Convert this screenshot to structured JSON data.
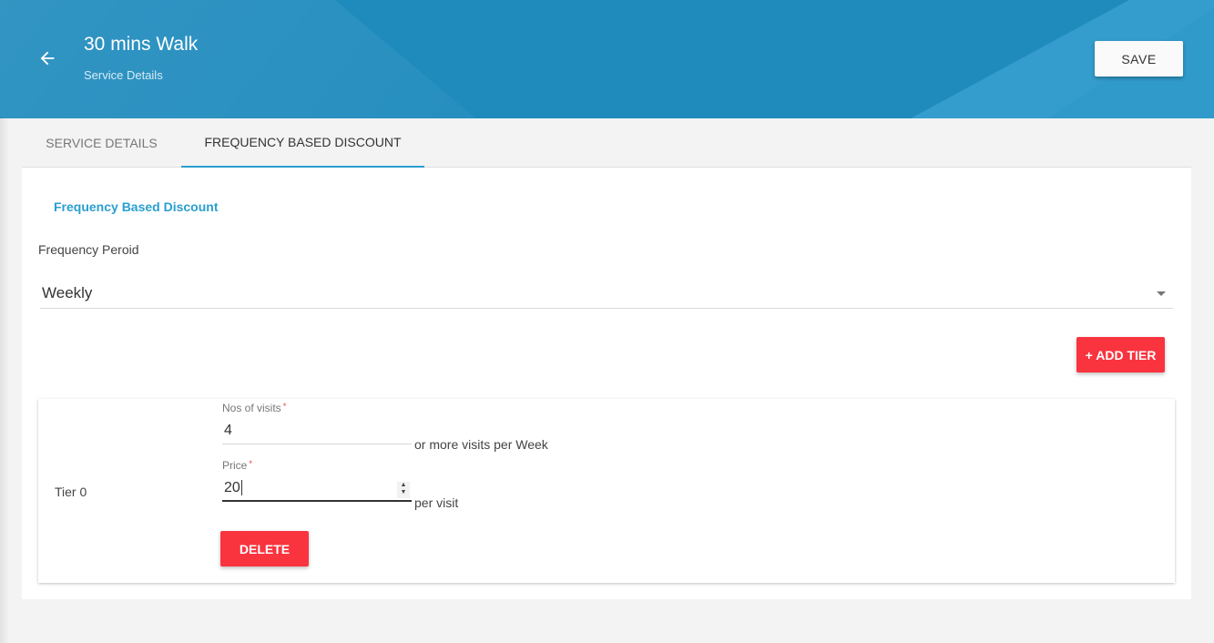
{
  "header": {
    "title": "30 mins Walk",
    "subtitle": "Service Details",
    "back_icon": "arrow-left-icon",
    "save_label": "SAVE"
  },
  "tabs": [
    {
      "label": "SERVICE DETAILS",
      "active": false
    },
    {
      "label": "FREQUENCY BASED DISCOUNT",
      "active": true
    }
  ],
  "panel": {
    "section_title": "Frequency Based Discount",
    "frequency_period_label": "Frequency Peroid",
    "frequency_period_value": "Weekly",
    "add_tier_label": "+ ADD TIER"
  },
  "tiers": [
    {
      "label": "Tier 0",
      "visits_label": "Nos of visits",
      "visits_value": "4",
      "visits_suffix": "or more visits per Week",
      "price_label": "Price",
      "price_value": "20",
      "price_suffix": "per visit",
      "required_mark": "*",
      "delete_label": "DELETE"
    }
  ],
  "colors": {
    "header_bg": "#1f8bbd",
    "accent": "#2a9fd0",
    "danger": "#f9343f"
  }
}
